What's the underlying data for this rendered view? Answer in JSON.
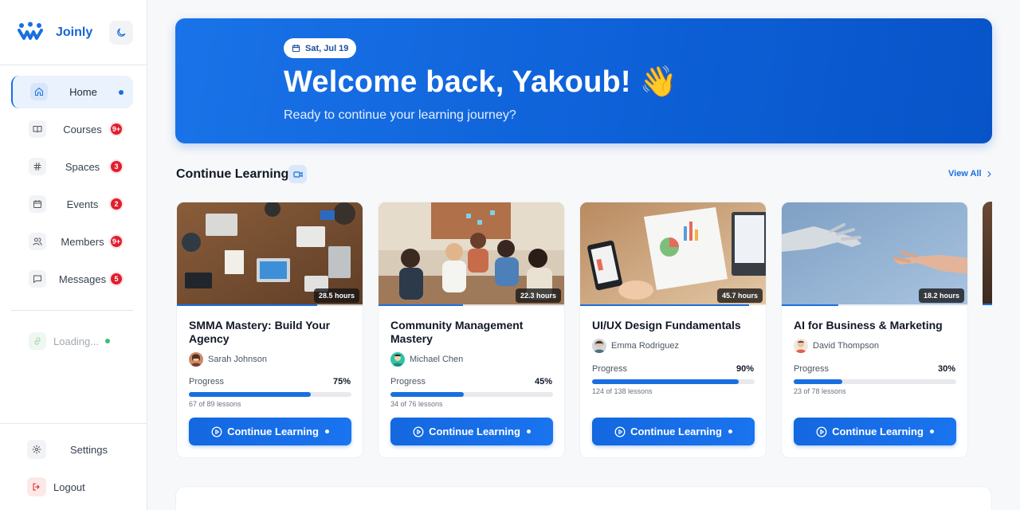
{
  "brand": {
    "name": "Joinly"
  },
  "sidebar": {
    "items": [
      {
        "label": "Home",
        "icon": "home-icon",
        "active": true
      },
      {
        "label": "Courses",
        "icon": "book-icon",
        "badge": "9+"
      },
      {
        "label": "Spaces",
        "icon": "hash-icon",
        "badge": "3"
      },
      {
        "label": "Events",
        "icon": "calendar-icon",
        "badge": "2"
      },
      {
        "label": "Members",
        "icon": "users-icon",
        "badge": "9+"
      },
      {
        "label": "Messages",
        "icon": "message-icon",
        "badge": "5"
      }
    ],
    "loading": {
      "label": "Loading...",
      "icon": "link-icon"
    },
    "settings": {
      "label": "Settings",
      "icon": "gear-icon"
    },
    "logout": {
      "label": "Logout",
      "icon": "logout-icon"
    }
  },
  "hero": {
    "date": "Sat, Jul 19",
    "title": "Welcome back, Yakoub! 👋",
    "subtitle": "Ready to continue your learning journey?"
  },
  "continue_learning": {
    "title": "Continue Learning",
    "view_all": "View All",
    "progress_label": "Progress",
    "button_label": "Continue Learning",
    "courses": [
      {
        "title": "SMMA Mastery: Build Your Agency",
        "author": "Sarah Johnson",
        "hours": "28.5 hours",
        "progress": "75%",
        "progress_value": 0.75,
        "lessons": "67 of 89 lessons"
      },
      {
        "title": "Community Management Mastery",
        "author": "Michael Chen",
        "hours": "22.3 hours",
        "progress": "45%",
        "progress_value": 0.45,
        "lessons": "34 of 76 lessons"
      },
      {
        "title": "UI/UX Design Fundamentals",
        "author": "Emma Rodriguez",
        "hours": "45.7 hours",
        "progress": "90%",
        "progress_value": 0.9,
        "lessons": "124 of 138 lessons"
      },
      {
        "title": "AI for Business & Marketing",
        "author": "David Thompson",
        "hours": "18.2 hours",
        "progress": "30%",
        "progress_value": 0.3,
        "lessons": "23 of 78 lessons"
      }
    ]
  },
  "colors": {
    "accent": "#1a6fe0",
    "badge": "#e11d2e",
    "online": "#37c07a"
  }
}
